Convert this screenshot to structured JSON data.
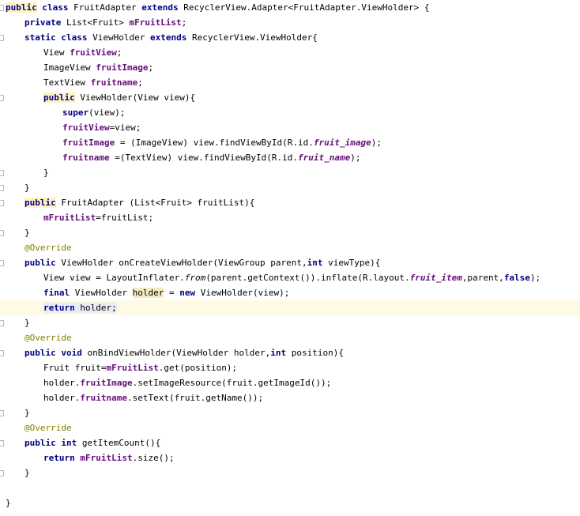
{
  "editor": {
    "lines": [
      {
        "indent": 0,
        "tokens": [
          {
            "t": "public",
            "c": "kw hl-kw"
          },
          {
            "t": " "
          },
          {
            "t": "class",
            "c": "kw"
          },
          {
            "t": " FruitAdapter "
          },
          {
            "t": "extends",
            "c": "kw"
          },
          {
            "t": " RecyclerView.Adapter<FruitAdapter.ViewHolder> {"
          }
        ]
      },
      {
        "indent": 1,
        "tokens": [
          {
            "t": "private",
            "c": "kw"
          },
          {
            "t": " List<Fruit> "
          },
          {
            "t": "mFruitList",
            "c": "fld"
          },
          {
            "t": ";"
          }
        ]
      },
      {
        "indent": 1,
        "tokens": [
          {
            "t": "static",
            "c": "kw"
          },
          {
            "t": " "
          },
          {
            "t": "class",
            "c": "kw"
          },
          {
            "t": " ViewHolder "
          },
          {
            "t": "extends",
            "c": "kw"
          },
          {
            "t": " RecyclerView.ViewHolder{"
          }
        ]
      },
      {
        "indent": 2,
        "tokens": [
          {
            "t": "View "
          },
          {
            "t": "fruitView",
            "c": "fld"
          },
          {
            "t": ";"
          }
        ]
      },
      {
        "indent": 2,
        "tokens": [
          {
            "t": "ImageView "
          },
          {
            "t": "fruitImage",
            "c": "fld"
          },
          {
            "t": ";"
          }
        ]
      },
      {
        "indent": 2,
        "tokens": [
          {
            "t": "TextView "
          },
          {
            "t": "fruitname",
            "c": "fld"
          },
          {
            "t": ";"
          }
        ]
      },
      {
        "indent": 2,
        "tokens": [
          {
            "t": "public",
            "c": "kw hl-kw"
          },
          {
            "t": " ViewHolder(View view){"
          }
        ]
      },
      {
        "indent": 3,
        "tokens": [
          {
            "t": "super",
            "c": "kw"
          },
          {
            "t": "(view);"
          }
        ]
      },
      {
        "indent": 3,
        "tokens": [
          {
            "t": "fruitView",
            "c": "fld"
          },
          {
            "t": "=view;"
          }
        ]
      },
      {
        "indent": 3,
        "tokens": [
          {
            "t": "fruitImage",
            "c": "fld"
          },
          {
            "t": " = (ImageView) view.findViewById(R.id."
          },
          {
            "t": "fruit_image",
            "c": "fldi"
          },
          {
            "t": ");"
          }
        ]
      },
      {
        "indent": 3,
        "tokens": [
          {
            "t": "fruitname",
            "c": "fld"
          },
          {
            "t": " =(TextView) view.findViewById(R.id."
          },
          {
            "t": "fruit_name",
            "c": "fldi"
          },
          {
            "t": ");"
          }
        ]
      },
      {
        "indent": 2,
        "tokens": [
          {
            "t": "}"
          }
        ]
      },
      {
        "indent": 1,
        "tokens": [
          {
            "t": "}"
          }
        ]
      },
      {
        "indent": 1,
        "tokens": [
          {
            "t": "public",
            "c": "kw hl-kw"
          },
          {
            "t": " FruitAdapter (List<Fruit> fruitList){"
          }
        ]
      },
      {
        "indent": 2,
        "tokens": [
          {
            "t": "mFruitList",
            "c": "fld"
          },
          {
            "t": "=fruitList;"
          }
        ]
      },
      {
        "indent": 1,
        "tokens": [
          {
            "t": "}"
          }
        ]
      },
      {
        "indent": 1,
        "tokens": [
          {
            "t": "@Override",
            "c": "ann"
          }
        ]
      },
      {
        "indent": 1,
        "tokens": [
          {
            "t": "public",
            "c": "kw"
          },
          {
            "t": " ViewHolder onCreateViewHolder(ViewGroup parent,"
          },
          {
            "t": "int",
            "c": "kw"
          },
          {
            "t": " viewType){"
          }
        ]
      },
      {
        "indent": 2,
        "tokens": [
          {
            "t": "View view = LayoutInflater."
          },
          {
            "t": "from",
            "c": "ital"
          },
          {
            "t": "(parent.getContext()).inflate(R.layout."
          },
          {
            "t": "fruit_item",
            "c": "fldi"
          },
          {
            "t": ",parent,"
          },
          {
            "t": "false",
            "c": "kw"
          },
          {
            "t": ");"
          }
        ]
      },
      {
        "indent": 2,
        "tokens": [
          {
            "t": "final",
            "c": "kw"
          },
          {
            "t": " ViewHolder "
          },
          {
            "t": "holder",
            "c": "hl-id"
          },
          {
            "t": " = "
          },
          {
            "t": "new",
            "c": "kw"
          },
          {
            "t": " ViewHolder(view);"
          }
        ]
      },
      {
        "indent": 2,
        "current": true,
        "tokens": [
          {
            "t": "return",
            "c": "kw hl-sel"
          },
          {
            "t": " holder;",
            "c": "hl-sel"
          }
        ]
      },
      {
        "indent": 1,
        "tokens": [
          {
            "t": "}"
          }
        ]
      },
      {
        "indent": 1,
        "tokens": [
          {
            "t": "@Override",
            "c": "ann"
          }
        ]
      },
      {
        "indent": 1,
        "tokens": [
          {
            "t": "public",
            "c": "kw"
          },
          {
            "t": " "
          },
          {
            "t": "void",
            "c": "kw"
          },
          {
            "t": " onBindViewHolder(ViewHolder holder,"
          },
          {
            "t": "int",
            "c": "kw"
          },
          {
            "t": " position){"
          }
        ]
      },
      {
        "indent": 2,
        "tokens": [
          {
            "t": "Fruit fruit="
          },
          {
            "t": "mFruitList",
            "c": "fld"
          },
          {
            "t": ".get(position);"
          }
        ]
      },
      {
        "indent": 2,
        "tokens": [
          {
            "t": "holder."
          },
          {
            "t": "fruitImage",
            "c": "fld"
          },
          {
            "t": ".setImageResource(fruit.getImageId());"
          }
        ]
      },
      {
        "indent": 2,
        "tokens": [
          {
            "t": "holder."
          },
          {
            "t": "fruitname",
            "c": "fld"
          },
          {
            "t": ".setText(fruit.getName());"
          }
        ]
      },
      {
        "indent": 1,
        "tokens": [
          {
            "t": "}"
          }
        ]
      },
      {
        "indent": 1,
        "tokens": [
          {
            "t": "@Override",
            "c": "ann"
          }
        ]
      },
      {
        "indent": 1,
        "tokens": [
          {
            "t": "public",
            "c": "kw"
          },
          {
            "t": " "
          },
          {
            "t": "int",
            "c": "kw"
          },
          {
            "t": " getItemCount(){"
          }
        ]
      },
      {
        "indent": 2,
        "tokens": [
          {
            "t": "return",
            "c": "kw"
          },
          {
            "t": " "
          },
          {
            "t": "mFruitList",
            "c": "fld"
          },
          {
            "t": ".size();"
          }
        ]
      },
      {
        "indent": 1,
        "tokens": [
          {
            "t": "}"
          }
        ]
      },
      {
        "indent": 0,
        "tokens": [
          {
            "t": ""
          }
        ]
      },
      {
        "indent": 0,
        "tokens": [
          {
            "t": "}"
          }
        ]
      }
    ]
  }
}
